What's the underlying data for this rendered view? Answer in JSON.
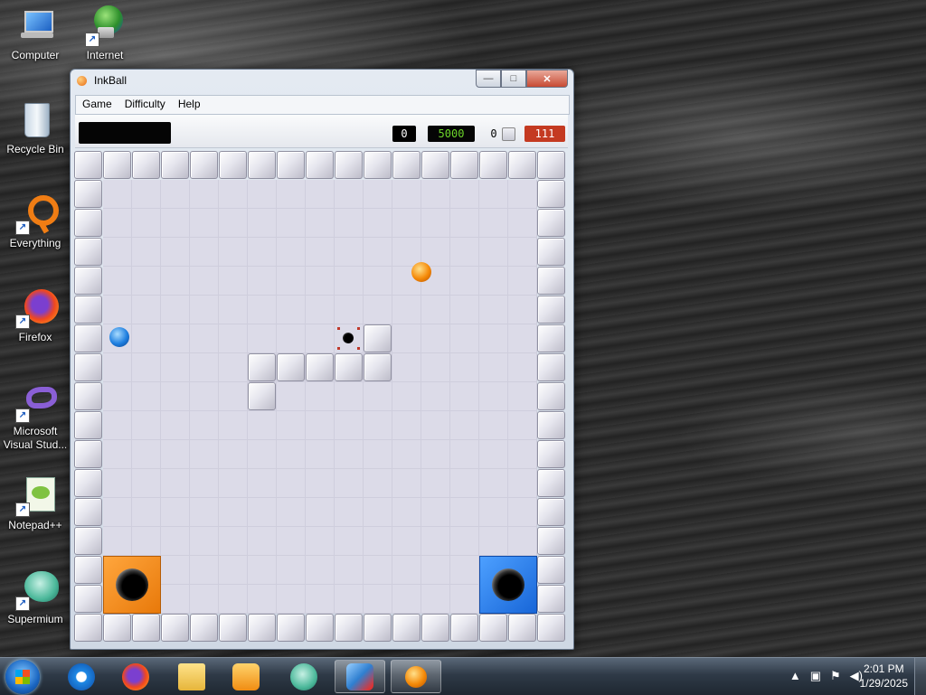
{
  "desktop": {
    "icons": [
      {
        "label": "Computer",
        "icon": "computer-icon"
      },
      {
        "label": "Internet",
        "icon": "internet-icon"
      },
      {
        "label": "Recycle Bin",
        "icon": "recycle-bin-icon"
      },
      {
        "label": "Everything",
        "icon": "everything-icon"
      },
      {
        "label": "Firefox",
        "icon": "firefox-icon"
      },
      {
        "label": "Microsoft Visual Stud...",
        "icon": "visual-studio-icon"
      },
      {
        "label": "Notepad++",
        "icon": "notepadpp-icon"
      },
      {
        "label": "Supermium",
        "icon": "supermium-icon"
      }
    ]
  },
  "window": {
    "title": "InkBall",
    "controls": {
      "minimize": "—",
      "maximize": "□",
      "close": "✕"
    },
    "menu": [
      "Game",
      "Difficulty",
      "Help"
    ]
  },
  "status": {
    "score": "0",
    "bonus": "5000",
    "balls": "0",
    "time": "111"
  },
  "colors": {
    "orange": "#f08a0e",
    "blue": "#1e7fe0",
    "time_bg": "#c43a21",
    "bonus_text": "#6cd62a"
  },
  "board": {
    "grid_size": 17,
    "inner_walls": [
      [
        10,
        6
      ],
      [
        6,
        7
      ],
      [
        7,
        7
      ],
      [
        8,
        7
      ],
      [
        9,
        7
      ],
      [
        10,
        7
      ],
      [
        6,
        8
      ]
    ],
    "gray_hole": [
      9,
      6
    ],
    "holes": [
      {
        "color": "orange",
        "col": 1,
        "row": 14
      },
      {
        "color": "blue",
        "col": 14,
        "row": 14
      }
    ],
    "balls": [
      {
        "color": "orange",
        "col": 11.5,
        "row": 3.7
      },
      {
        "color": "blue",
        "col": 1.05,
        "row": 5.95
      }
    ]
  },
  "taskbar": {
    "pinned": [
      "internet-explorer-icon",
      "firefox-icon",
      "file-explorer-icon",
      "media-player-icon",
      "supermium-icon",
      "network-app-icon",
      "inkball-icon"
    ],
    "active": "inkball-icon",
    "tray": [
      "up-arrow-icon",
      "network-icon",
      "flag-icon",
      "volume-icon"
    ],
    "time": "2:01 PM",
    "date": "1/29/2025"
  }
}
